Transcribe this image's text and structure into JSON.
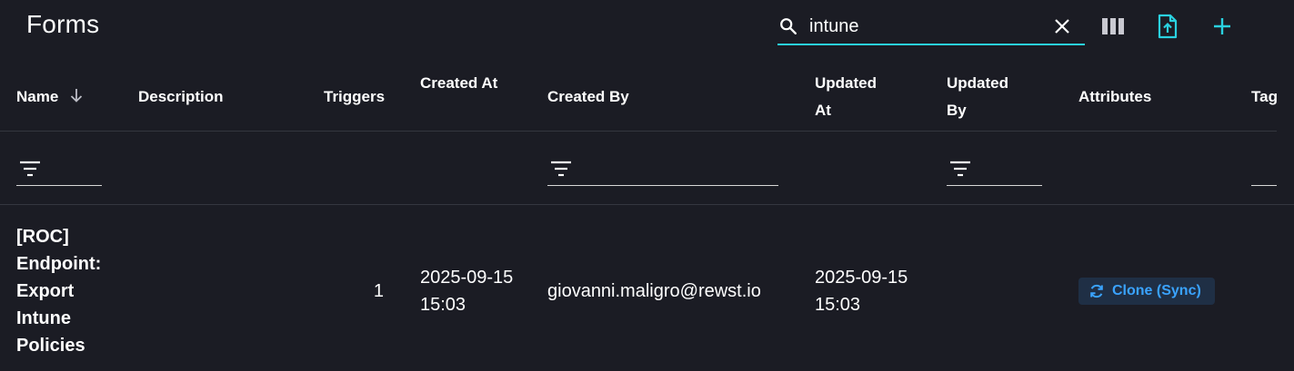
{
  "page": {
    "title": "Forms"
  },
  "search": {
    "value": "intune",
    "placeholder": ""
  },
  "toolbar": {
    "columns_icon": "columns-icon",
    "export_icon": "file-upload-icon",
    "add_icon": "plus-icon"
  },
  "table": {
    "columns": [
      {
        "label": "Name",
        "sort": "descending"
      },
      {
        "label": "Description"
      },
      {
        "label": "Triggers"
      },
      {
        "label": "Created At"
      },
      {
        "label": "Created By"
      },
      {
        "label": "Updated At"
      },
      {
        "label": "Updated By"
      },
      {
        "label": "Attributes"
      },
      {
        "label": "Tag"
      }
    ],
    "rows": [
      {
        "name": "[ROC] Endpoint: Export Intune Policies",
        "description": "",
        "triggers": "1",
        "created_at": "2025-09-15 15:03",
        "created_by": "giovanni.maligro@rewst.io",
        "updated_at": "2025-09-15 15:03",
        "updated_by": "",
        "attribute_badge": "Clone (Sync)",
        "tag": ""
      }
    ]
  },
  "colors": {
    "background": "#1b1c24",
    "accent": "#2ad1e0",
    "badge_bg": "#1f2f45",
    "badge_text": "#3aa3ff"
  }
}
